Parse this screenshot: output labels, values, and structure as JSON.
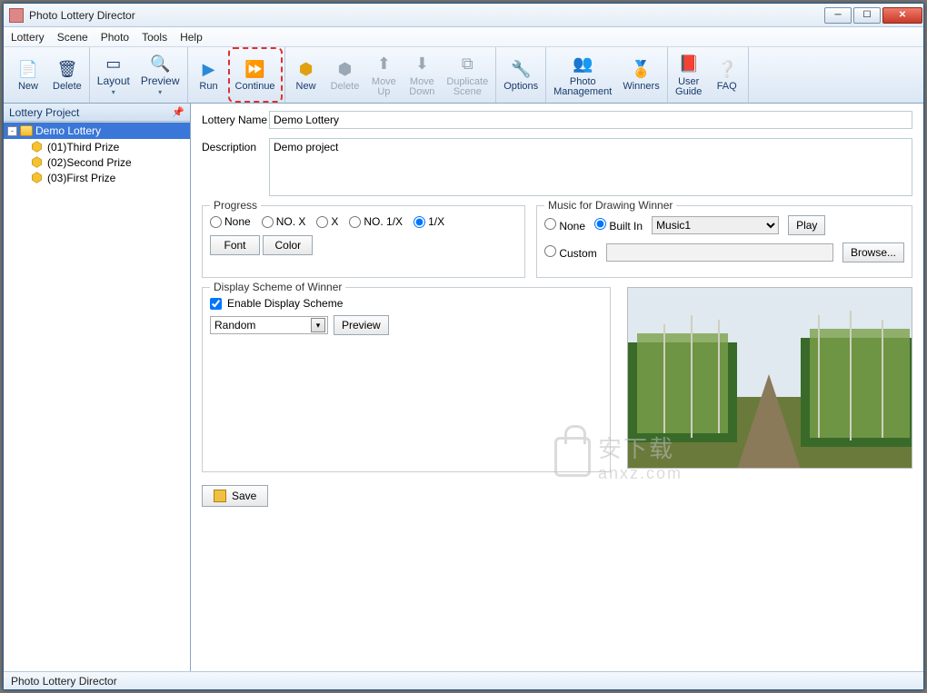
{
  "window": {
    "title": "Photo Lottery Director"
  },
  "menu": {
    "items": [
      "Lottery",
      "Scene",
      "Photo",
      "Tools",
      "Help"
    ]
  },
  "toolbar": {
    "new": "New",
    "delete": "Delete",
    "layout": "Layout",
    "preview": "Preview",
    "run": "Run",
    "continue": "Continue",
    "snew": "New",
    "sdelete": "Delete",
    "moveup": "Move\nUp",
    "movedown": "Move\nDown",
    "dup": "Duplicate\nScene",
    "options": "Options",
    "photomgmt": "Photo\nManagement",
    "winners": "Winners",
    "guide": "User\nGuide",
    "faq": "FAQ"
  },
  "sidebar": {
    "header": "Lottery Project",
    "root": "Demo Lottery",
    "children": [
      "(01)Third Prize",
      "(02)Second Prize",
      "(03)First Prize"
    ]
  },
  "form": {
    "name_label": "Lottery Name",
    "name_value": "Demo Lottery",
    "desc_label": "Description",
    "desc_value": "Demo project"
  },
  "progress": {
    "legend": "Progress",
    "options": [
      "None",
      "NO. X",
      "X",
      "NO. 1/X",
      "1/X"
    ],
    "selected": "1/X",
    "font_btn": "Font",
    "color_btn": "Color"
  },
  "music": {
    "legend": "Music for Drawing Winner",
    "none": "None",
    "builtin": "Built In",
    "custom": "Custom",
    "selected": "Built In",
    "track": "Music1",
    "play": "Play",
    "browse": "Browse..."
  },
  "display": {
    "legend": "Display Scheme of Winner",
    "enable_label": "Enable Display Scheme",
    "enabled": true,
    "scheme": "Random",
    "preview_btn": "Preview"
  },
  "save_btn": "Save",
  "status": "Photo Lottery Director",
  "watermark": {
    "cn": "安下载",
    "domain": "anxz.com"
  }
}
